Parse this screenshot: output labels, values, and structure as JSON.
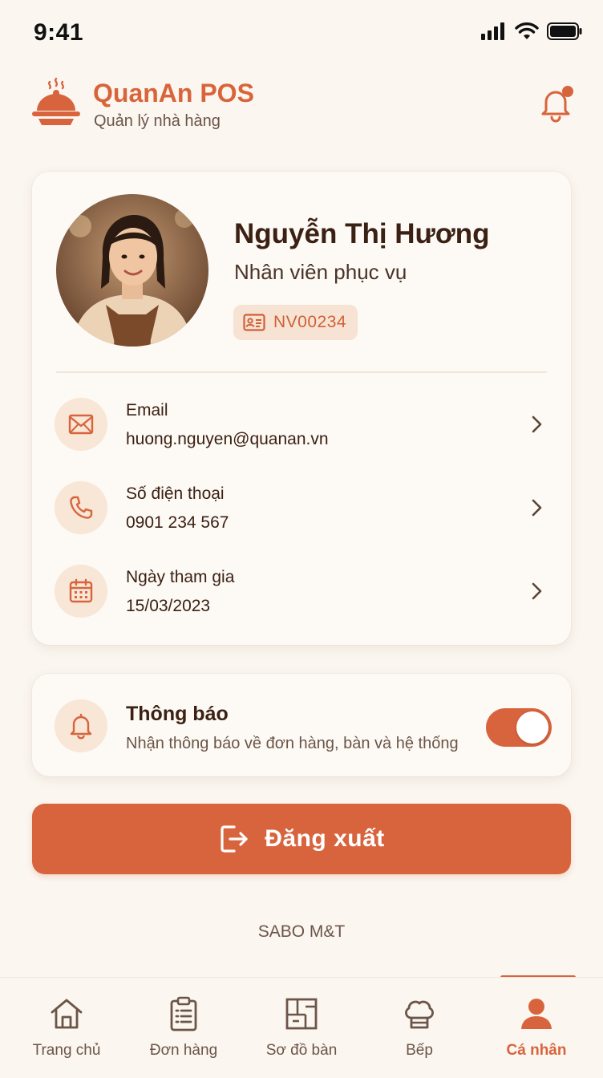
{
  "status_bar": {
    "time": "9:41"
  },
  "header": {
    "app_name": "QuanAn POS",
    "subtitle": "Quản lý nhà hàng"
  },
  "profile": {
    "name": "Nguyễn Thị Hương",
    "role": "Nhân viên phục vụ",
    "employee_id": "NV00234",
    "rows": [
      {
        "label": "Email",
        "value": "huong.nguyen@quanan.vn",
        "icon": "mail-icon"
      },
      {
        "label": "Số điện thoại",
        "value": "0901 234 567",
        "icon": "phone-icon"
      },
      {
        "label": "Ngày tham gia",
        "value": "15/03/2023",
        "icon": "calendar-icon"
      }
    ]
  },
  "notifications": {
    "title": "Thông báo",
    "description": "Nhận thông báo về đơn hàng, bàn và hệ thống",
    "enabled": true
  },
  "logout": {
    "label": "Đăng xuất"
  },
  "footer": {
    "brand": "SABO M&T"
  },
  "bottom_nav": {
    "items": [
      {
        "label": "Trang chủ",
        "icon": "home-icon"
      },
      {
        "label": "Đơn hàng",
        "icon": "clipboard-icon"
      },
      {
        "label": "Sơ đồ bàn",
        "icon": "floorplan-icon"
      },
      {
        "label": "Bếp",
        "icon": "chef-hat-icon"
      },
      {
        "label": "Cá nhân",
        "icon": "person-icon"
      }
    ],
    "active_index": 4
  },
  "colors": {
    "accent": "#d8643d",
    "background": "#fbf6f0",
    "card": "#fdf9f4",
    "icon_circle": "#f8e6d6",
    "text_dark": "#3b2114",
    "text_muted": "#6b5548"
  }
}
